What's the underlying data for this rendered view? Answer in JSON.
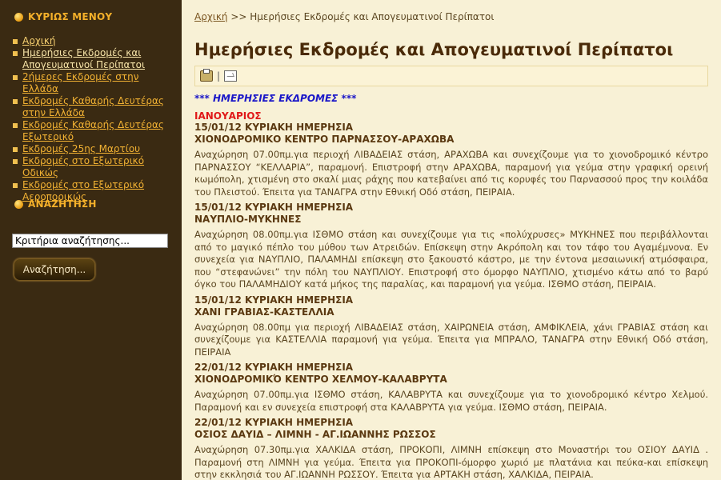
{
  "sidebar": {
    "menu_title": "ΚΥΡΙΩΣ ΜΕΝΟΥ",
    "items": [
      {
        "label": "Αρχική"
      },
      {
        "label": "Ημερήσιες Εκδρομές και Απογευματινοί Περίπατοι"
      },
      {
        "label": "2ήμερες Εκδρομές στην Ελλάδα"
      },
      {
        "label": "Εκδρομές Καθαρής Δευτέρας στην Ελλάδα"
      },
      {
        "label": "Εκδρομές Καθαρής Δευτέρας Εξωτερικό"
      },
      {
        "label": "Εκδρομές 25ης Μαρτίου"
      },
      {
        "label": "Εκδρομές στο Εξωτερικό Οδικώς"
      },
      {
        "label": "Εκδρομές στο Εξωτερικό Αεροπορικώς"
      }
    ],
    "search_title": "ΑΝΑΖΗΤΗΣΗ",
    "search_value": "Κριτήρια αναζήτησης...",
    "search_button": "Αναζήτηση..."
  },
  "main": {
    "breadcrumb_home": "Αρχική",
    "breadcrumb_sep": ">>",
    "breadcrumb_current": "Ημερήσιες Εκδρομές και Απογευματινοί Περίπατοι",
    "title": "Ημερήσιες Εκδρομές και Απογευματινοί Περίπατοι",
    "toolbar_sep": "|",
    "section_head": "*** ΗΜΕΡΗΣΙΕΣ ΕΚΔΡΟΜΕΣ ***",
    "month": "ΙΑΝΟΥΑΡΙΟΣ",
    "trips": [
      {
        "date": "15/01/12 ΚΥΡΙΑΚΗ ΗΜΕΡΗΣΙΑ",
        "place": "ΧΙΟΝΟΔΡΟΜΙΚΟ ΚΕΝΤΡΟ ΠΑΡΝΑΣΣΟΥ-ΑΡΑΧΩΒΑ",
        "desc": "Αναχώρηση 07.00πμ.για περιοχή ΛΙΒΑΔΕΙΑΣ στάση, ΑΡΑΧΩΒΑ και συνεχίζουμε για το χιονοδρομικό κέντρο ΠΑΡΝΑΣΣΟΥ “ΚΕΛΛΑΡΙΑ”, παραμονή. Επιστροφή στην ΑΡΑΧΩΒΑ, παραμονή για γεύμα στην γραφική ορεινή κωμόπολη, χτισμένη στο σκαλί μιας ράχης που κατεβαίνει από τις κορυφές του Παρνασσού προς την κοιλάδα του Πλειστού. Έπειτα για ΤΑΝΑΓΡΑ στην Εθνική Οδό στάση, ΠΕΙΡΑΙΑ."
      },
      {
        "date": "15/01/12 ΚΥΡΙΑΚΗ ΗΜΕΡΗΣΙΑ",
        "place": "ΝΑΥΠΛΙΟ-ΜΥΚΗΝΕΣ",
        "desc": "Αναχώρηση 08.00πμ.για ΙΣΘΜΟ στάση και συνεχίζουμε για τις «πολύχρυσες» ΜΥΚΗΝΕΣ που περιβάλλονται από το μαγικό πέπλο του μύθου των Ατρειδών. Επίσκεψη στην Ακρόπολη και τον τάφο του Αγαμέμνονα. Εν συνεχεία για ΝΑΥΠΛΙΟ, ΠΑΛΑΜΗΔΙ επίσκεψη στο ξακουστό κάστρο, με την έντονα μεσαιωνική ατμόσφαιρα, που “στεφανώνει” την πόλη του ΝΑΥΠΛΙΟΥ. Επιστροφή στο όμορφο ΝΑΥΠΛΙΟ, χτισμένο κάτω από το βαρύ όγκο του ΠΑΛΑΜΗΔΙΟΥ κατά μήκος της παραλίας, και παραμονή για γεύμα. ΙΣΘΜΟ στάση, ΠΕΙΡΑΙΑ."
      },
      {
        "date": "15/01/12 ΚΥΡΙΑΚΗ ΗΜΕΡΗΣΙΑ",
        "place": "ΧΑΝΙ ΓΡΑΒΙΑΣ-ΚΑΣΤΕΛΛΙΑ",
        "desc": "Αναχώρηση 08.00πμ για περιοχή ΛΙΒΑΔΕΙΑΣ στάση, ΧΑΙΡΩΝΕΙΑ στάση, ΑΜΦΙΚΛΕΙΑ, χάνι ΓΡΑΒΙΑΣ στάση και συνεχίζουμε για ΚΑΣΤΕΛΛΙΑ παραμονή για γεύμα. Έπειτα για ΜΠΡΑΛΟ, ΤΑΝΑΓΡΑ στην Εθνική Οδό στάση, ΠΕΙΡΑΙΑ"
      },
      {
        "date": "22/01/12 ΚΥΡΙΑΚΗ ΗΜΕΡΗΣΙΑ",
        "place": "ΧΙΟΝΟΔΡΟΜΙΚΌ ΚΕΝΤΡΟ ΧΕΛΜΟΥ-ΚΑΛΑΒΡΥΤΑ",
        "desc": "Αναχώρηση 07.00πμ.για ΙΣΘΜΟ στάση, ΚΑΛΑΒΡΥΤΑ και συνεχίζουμε για το χιονοδρομικό κέντρο Χελμού. Παραμονή και εν συνεχεία επιστροφή στα ΚΑΛΑΒΡΥΤΑ για γεύμα. ΙΣΘΜΟ στάση, ΠΕΙΡΑΙΑ."
      },
      {
        "date": "22/01/12 ΚΥΡΙΑΚΗ ΗΜΕΡΗΣΙΑ",
        "place": "ΟΣΙΟΣ ΔΑΥΙΔ – ΛΙΜΝΗ - ΑΓ.ΙΩΑΝΝΗΣ ΡΩΣΣΟΣ",
        "desc": "Αναχώρηση 07.30πμ.για ΧΑΛΚΙΔΑ στάση, ΠΡΟΚΟΠΙ, ΛΙΜΝΗ επίσκεψη στο Μοναστήρι του ΟΣΙΟΥ ΔΑΥΙΔ . Παραμονή στη ΛΙΜΝΗ για γεύμα. Έπειτα για ΠΡΟΚΟΠΙ-όμορφο χωριό με πλατάνια και πεύκα-και επίσκεψη στην εκκλησιά του ΑΓ.ΙΩΑΝΝΗ ΡΩΣΣΟΥ. Έπειτα για ΑΡΤΑΚΗ στάση, ΧΑΛΚΙΔΑ, ΠΕΙΡΑΙΑ."
      }
    ]
  },
  "colors": {
    "sidebar_bg": "#3a2a12",
    "main_bg": "#f8f1d6",
    "menu_title": "#f4b02a",
    "link": "#f2b233",
    "title": "#4a2a08",
    "section_head": "#1a16c8",
    "month": "#e01818"
  }
}
